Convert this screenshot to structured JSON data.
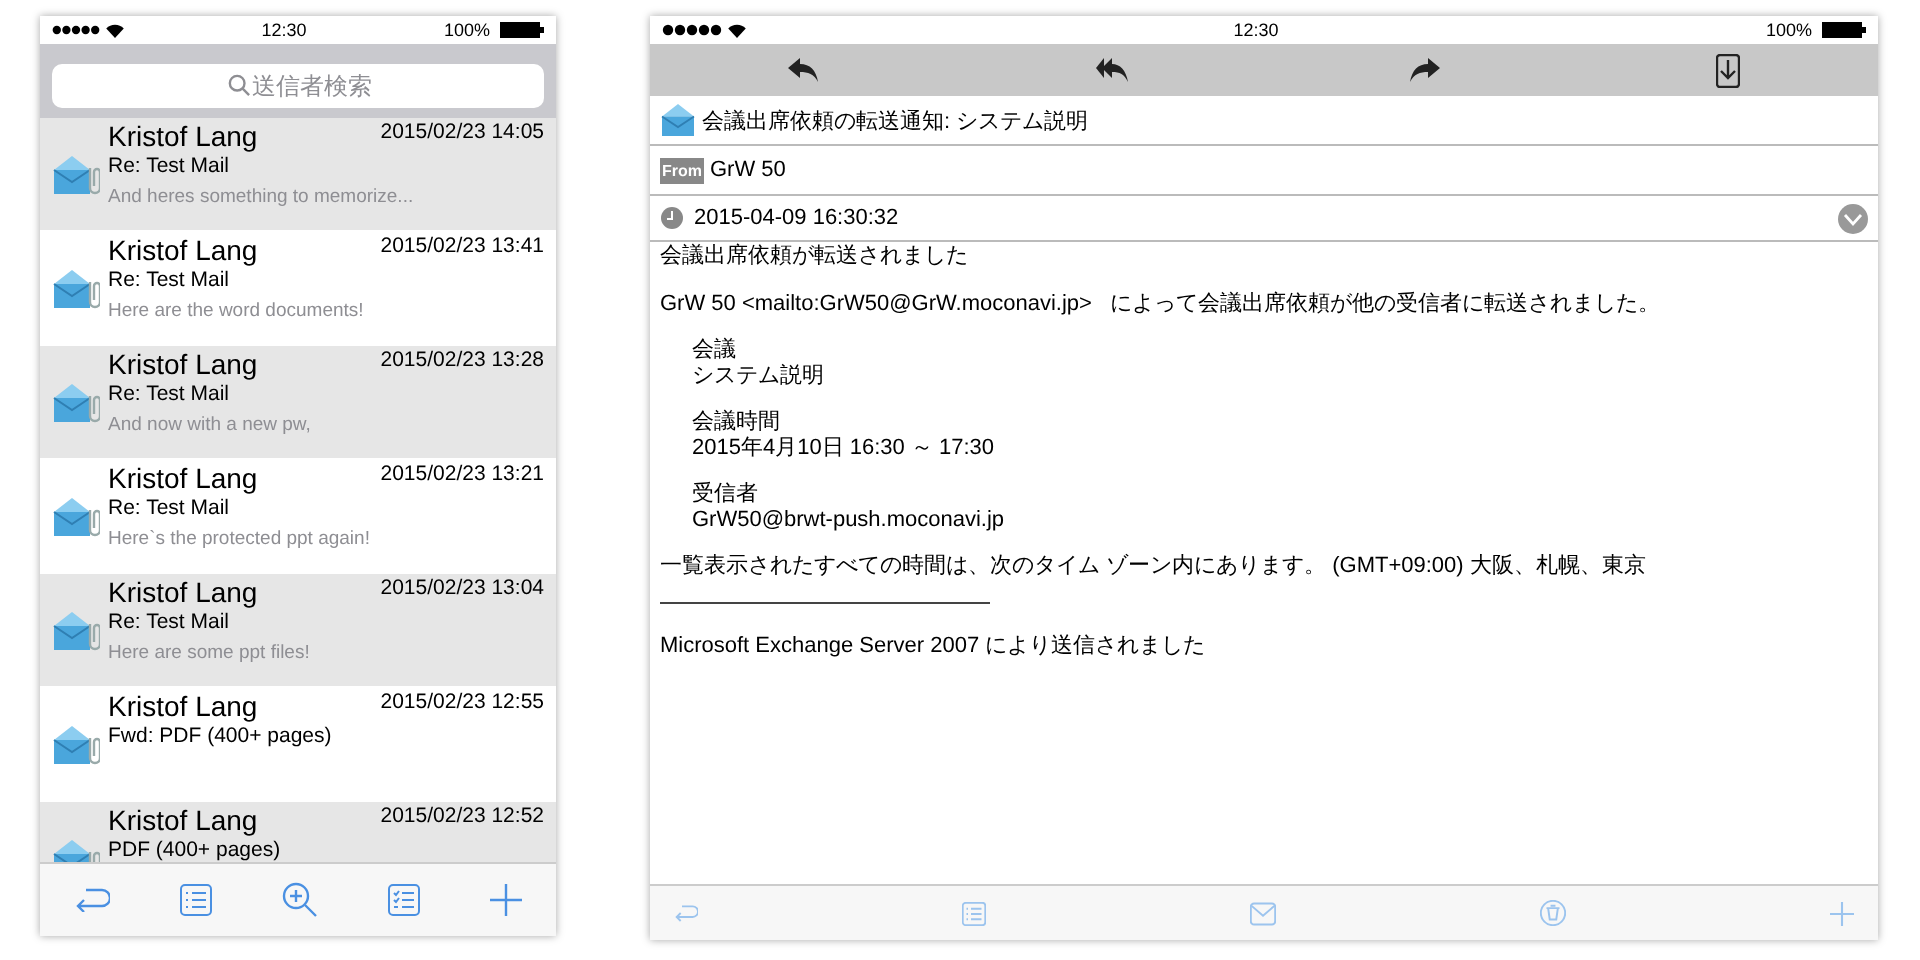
{
  "phone": {
    "status_bar": {
      "time": "12:30",
      "battery": "100%"
    },
    "search": {
      "placeholder": "送信者検索"
    },
    "mails": [
      {
        "sender": "Kristof Lang",
        "date": "2015/02/23 14:05",
        "subject": "Re: Test Mail",
        "preview": "And heres something to memorize..."
      },
      {
        "sender": "Kristof Lang",
        "date": "2015/02/23 13:41",
        "subject": "Re: Test Mail",
        "preview": "Here are the word documents!"
      },
      {
        "sender": "Kristof Lang",
        "date": "2015/02/23 13:28",
        "subject": "Re: Test Mail",
        "preview": "And now with a new pw,"
      },
      {
        "sender": "Kristof Lang",
        "date": "2015/02/23 13:21",
        "subject": "Re: Test Mail",
        "preview": "Here`s the protected ppt again!"
      },
      {
        "sender": "Kristof Lang",
        "date": "2015/02/23 13:04",
        "subject": "Re: Test Mail",
        "preview": "Here are some ppt files!"
      },
      {
        "sender": "Kristof Lang",
        "date": "2015/02/23 12:55",
        "subject": "Fwd: PDF (400+ pages)"
      },
      {
        "sender": "Kristof Lang",
        "date": "2015/02/23 12:52",
        "subject": "PDF (400+ pages)"
      }
    ]
  },
  "tablet": {
    "status_bar": {
      "time": "12:30",
      "battery": "100%"
    },
    "subject": "会議出席依頼の転送通知: システム説明",
    "from_badge": "From",
    "from": "GrW 50",
    "date": "2015-04-09 16:30:32",
    "body": [
      {
        "kind": "para",
        "lines": [
          "会議出席依頼が転送されました"
        ]
      },
      {
        "kind": "para",
        "lines": [
          "GrW 50 <mailto:GrW50@GrW.moconavi.jp>   によって会議出席依頼が他の受信者に転送されました。"
        ]
      },
      {
        "kind": "indent",
        "lines": [
          "会議",
          "システム説明"
        ]
      },
      {
        "kind": "indent",
        "lines": [
          "会議時間",
          "2015年4月10日 16:30 ～ 17:30"
        ]
      },
      {
        "kind": "indent",
        "lines": [
          "受信者",
          "GrW50@brwt-push.moconavi.jp"
        ]
      },
      {
        "kind": "para",
        "lines": [
          "一覧表示されたすべての時間は、次のタイム ゾーン内にあります。 (GMT+09:00) 大阪、札幌、東京"
        ]
      },
      {
        "kind": "rule"
      },
      {
        "kind": "para",
        "lines": [
          "Microsoft Exchange Server 2007 により送信されました"
        ]
      }
    ]
  }
}
